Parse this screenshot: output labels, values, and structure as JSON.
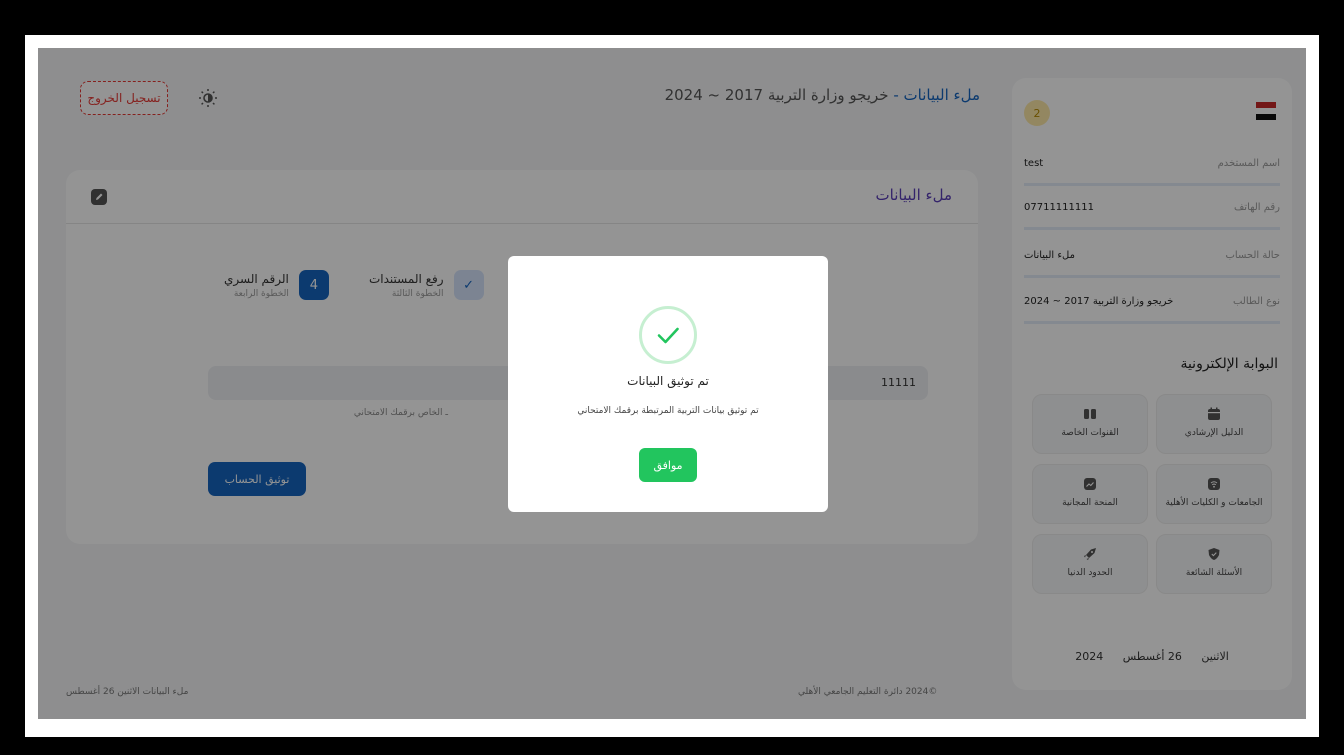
{
  "header": {
    "logout_label": "تسجيل الخروج",
    "title_prefix": "ملء البيانات",
    "title_separator": " - ",
    "title_suffix": "خريجو وزارة التربية 2017 ~ 2024"
  },
  "card": {
    "title": "ملء البيانات",
    "steps": [
      {
        "title": "الرقم السري",
        "subtitle": "الخطوة الرابعة",
        "number": "4"
      },
      {
        "title": "رفع المستندات",
        "subtitle": "الخطوة الثالثة",
        "number": "✓"
      }
    ],
    "field_value": "11111",
    "hint": "ـ الخاص برقمك الامتحاني",
    "verify_label": "توثيق الحساب"
  },
  "footer": {
    "left": "ملء البيانات   الاثنين  26 أغسطس",
    "right": "©2024 دائرة التعليم الجامعي الأهلي"
  },
  "sidebar": {
    "notification_count": "2",
    "rows": [
      {
        "label": "اسم المستخدم",
        "value": "test"
      },
      {
        "label": "رقم الهاتف",
        "value": "07711111111"
      },
      {
        "label": "حالة الحساب",
        "value": "ملء البيانات"
      },
      {
        "label": "نوع الطالب",
        "value": "خريجو وزارة التربية 2017 ~ 2024"
      }
    ],
    "portal_title": "البوابة الإلكترونية",
    "tiles": [
      {
        "label": "الدليل الإرشادي",
        "icon": "calendar-icon"
      },
      {
        "label": "القنوات الخاصة",
        "icon": "columns-icon"
      },
      {
        "label": "الجامعات و الكليات الأهلية",
        "icon": "wifi-icon"
      },
      {
        "label": "المنحة المجانية",
        "icon": "chart-icon"
      },
      {
        "label": "الأسئلة الشائعة",
        "icon": "shield-icon"
      },
      {
        "label": "الحدود الدنيا",
        "icon": "rocket-icon"
      }
    ],
    "date": {
      "weekday": "الاثنين",
      "day_month": "26 أغسطس",
      "year": "2024"
    }
  },
  "modal": {
    "title": "تم توثيق البيانات",
    "text": "تم توثيق بيانات التربية المرتبطة برقمك الامتحاني",
    "ok_label": "موافق"
  },
  "colors": {
    "primary": "#1565c0",
    "success": "#22c55e",
    "danger": "#e53935",
    "accent_purple": "#5b3fb8"
  }
}
